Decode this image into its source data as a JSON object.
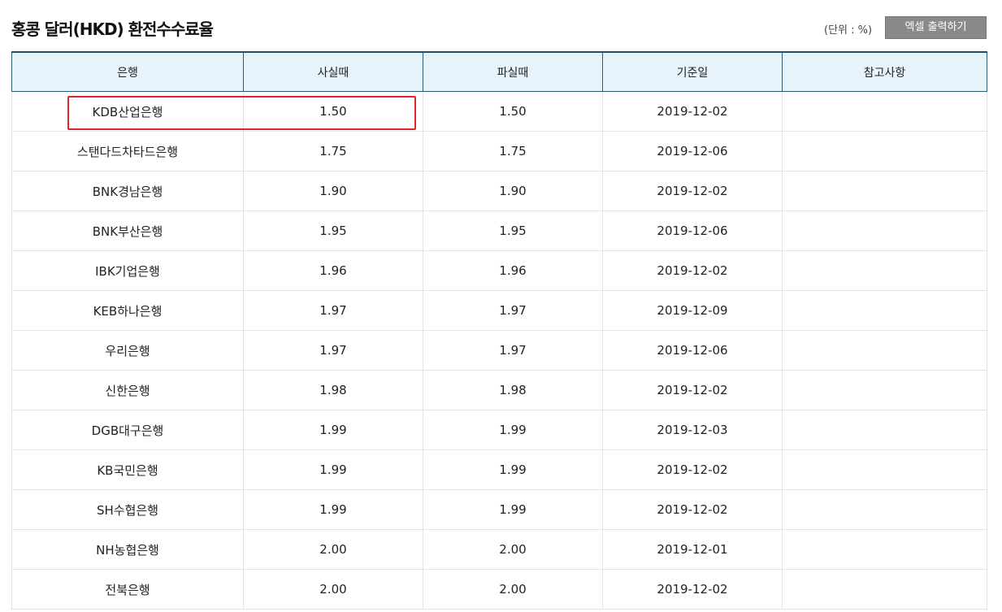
{
  "title": "홍콩 달러(HKD) 환전수수료율",
  "unit": "(단위 : %)",
  "excel_button": "엑셀 출력하기",
  "columns": [
    "은행",
    "사실때",
    "파실때",
    "기준일",
    "참고사항"
  ],
  "rows": [
    {
      "bank": "KDB산업은행",
      "buy": "1.50",
      "sell": "1.50",
      "date": "2019-12-02",
      "note": ""
    },
    {
      "bank": "스탠다드차타드은행",
      "buy": "1.75",
      "sell": "1.75",
      "date": "2019-12-06",
      "note": ""
    },
    {
      "bank": "BNK경남은행",
      "buy": "1.90",
      "sell": "1.90",
      "date": "2019-12-02",
      "note": ""
    },
    {
      "bank": "BNK부산은행",
      "buy": "1.95",
      "sell": "1.95",
      "date": "2019-12-06",
      "note": ""
    },
    {
      "bank": "IBK기업은행",
      "buy": "1.96",
      "sell": "1.96",
      "date": "2019-12-02",
      "note": ""
    },
    {
      "bank": "KEB하나은행",
      "buy": "1.97",
      "sell": "1.97",
      "date": "2019-12-09",
      "note": ""
    },
    {
      "bank": "우리은행",
      "buy": "1.97",
      "sell": "1.97",
      "date": "2019-12-06",
      "note": ""
    },
    {
      "bank": "신한은행",
      "buy": "1.98",
      "sell": "1.98",
      "date": "2019-12-02",
      "note": ""
    },
    {
      "bank": "DGB대구은행",
      "buy": "1.99",
      "sell": "1.99",
      "date": "2019-12-03",
      "note": ""
    },
    {
      "bank": "KB국민은행",
      "buy": "1.99",
      "sell": "1.99",
      "date": "2019-12-02",
      "note": ""
    },
    {
      "bank": "SH수협은행",
      "buy": "1.99",
      "sell": "1.99",
      "date": "2019-12-02",
      "note": ""
    },
    {
      "bank": "NH농협은행",
      "buy": "2.00",
      "sell": "2.00",
      "date": "2019-12-01",
      "note": ""
    },
    {
      "bank": "전북은행",
      "buy": "2.00",
      "sell": "2.00",
      "date": "2019-12-02",
      "note": ""
    }
  ],
  "colors": {
    "header_bg": "#e7f3fa",
    "header_border": "#2c5c72",
    "highlight": "#e0242b",
    "button_bg": "#8a8a8a"
  }
}
